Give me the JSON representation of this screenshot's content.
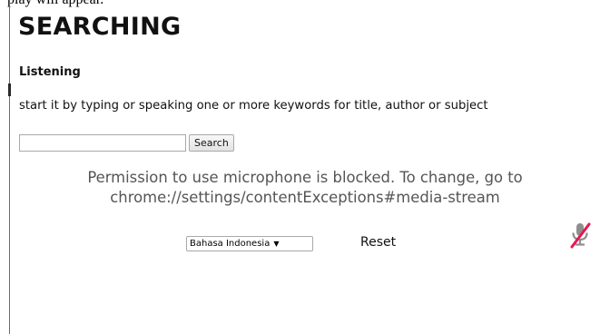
{
  "page": {
    "top_cut_text": "play will appear.",
    "heading": "SEARCHING",
    "subheading": "Listening",
    "instruction": "start it by typing or speaking one or more keywords for title, author or subject"
  },
  "search": {
    "input_value": "",
    "button_label": "Search"
  },
  "permission": {
    "line1": "Permission to use microphone is blocked. To change, go to",
    "line2": "chrome://settings/contentExceptions#media-stream",
    "color": "#555555"
  },
  "language": {
    "selected": "Bahasa Indonesia",
    "caret": "▼"
  },
  "controls": {
    "reset_label": "Reset",
    "mic_icon": "microphone-blocked-icon",
    "mic_slash_color": "#e8174f"
  }
}
